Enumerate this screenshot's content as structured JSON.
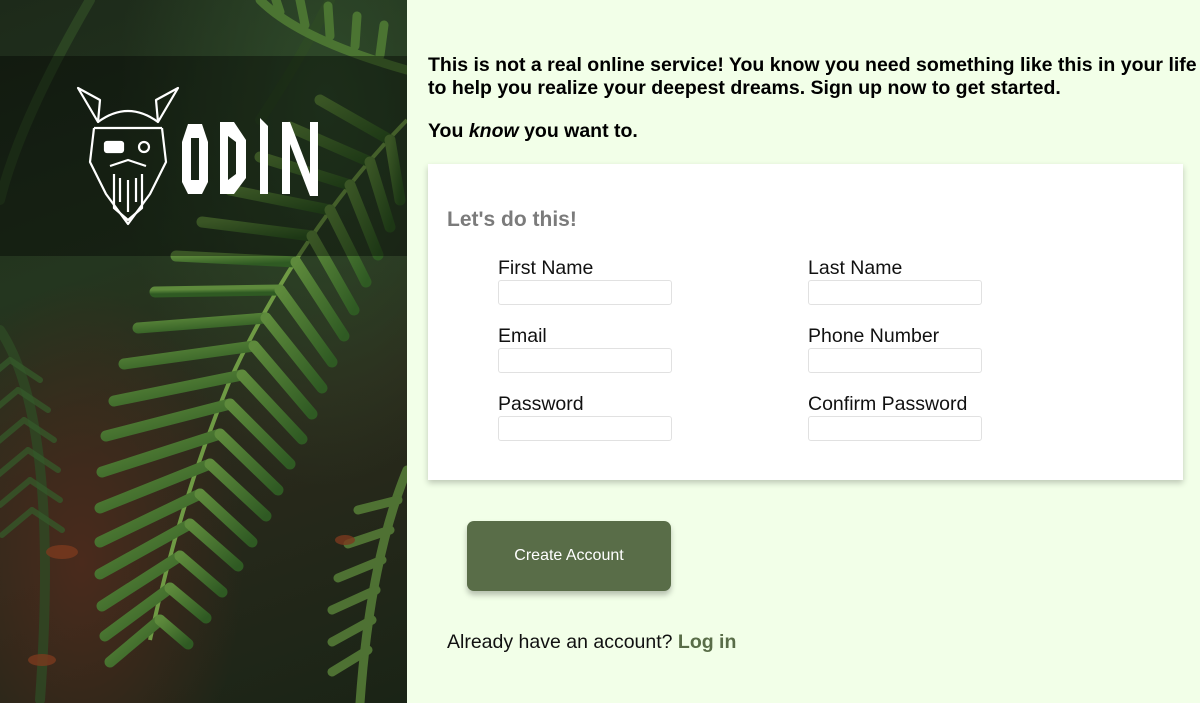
{
  "brand": {
    "name": "ODIN",
    "logo_icon": "odin-viking-helmet-icon",
    "hero_image": "fern-leaves-background"
  },
  "intro": {
    "paragraph": "This is not a real online service! You know you need something like this in your life to help you realize your deepest dreams. Sign up now to get started.",
    "line2_before": "You ",
    "line2_emphasis": "know",
    "line2_after": " you want to."
  },
  "form": {
    "title": "Let's do this!",
    "fields": [
      {
        "label": "First Name",
        "value": "",
        "placeholder": ""
      },
      {
        "label": "Last Name",
        "value": "",
        "placeholder": ""
      },
      {
        "label": "Email",
        "value": "",
        "placeholder": ""
      },
      {
        "label": "Phone Number",
        "value": "",
        "placeholder": ""
      },
      {
        "label": "Password",
        "value": "",
        "placeholder": ""
      },
      {
        "label": "Confirm Password",
        "value": "",
        "placeholder": ""
      }
    ]
  },
  "actions": {
    "create_label": "Create Account",
    "login_prompt": "Already have an account? ",
    "login_link": "Log in"
  },
  "colors": {
    "page_background": "#f2ffe8",
    "accent": "#596d48",
    "card_title": "#7b7b7b"
  }
}
